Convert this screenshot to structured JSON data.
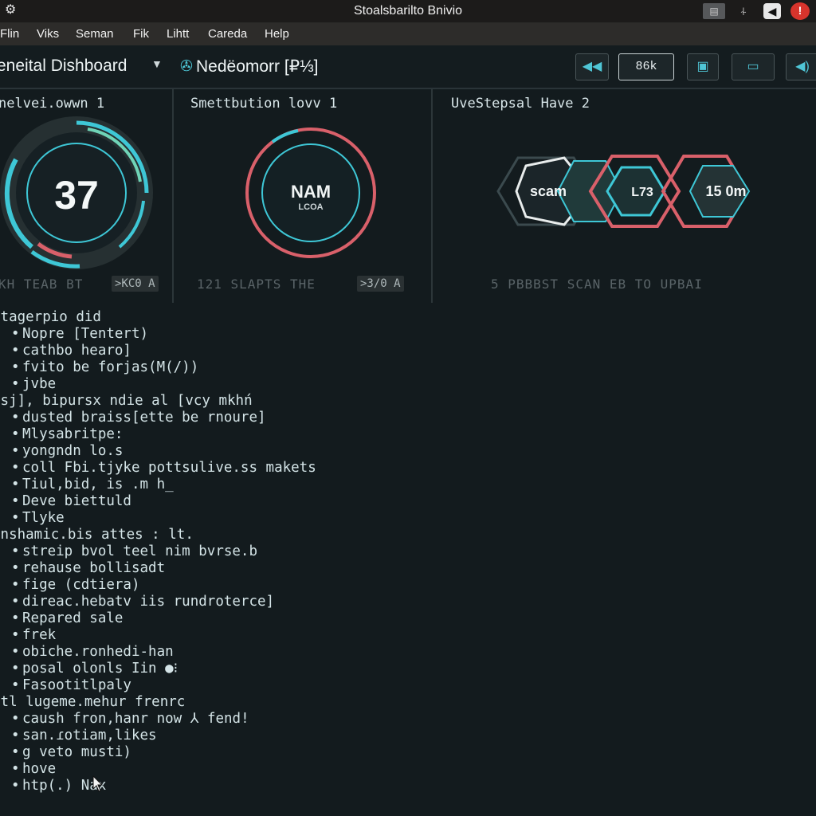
{
  "window": {
    "title": "Stoalsbarilto Bnivio"
  },
  "menu": [
    "Flin",
    "Viks",
    "Seman",
    "Fik",
    "Lihtt",
    "Careda",
    "Help"
  ],
  "toolbar": {
    "dashboard_title": "eneital Dishboard",
    "network_title": "Nedëomorr",
    "network_badge": "[₽⅓]",
    "speed_label": "86k"
  },
  "panels": [
    {
      "title": "nelvei.owwn 1",
      "gauge_value": "37",
      "footer_text": "KH TEAB BT",
      "footer_pill": ">KC0 A"
    },
    {
      "title": "Smettbution lovv 1",
      "gauge_line1": "NAM",
      "gauge_line2": "LCOA",
      "footer_text": "121 SLAPTS THE",
      "footer_pill": ">3/0 A"
    },
    {
      "title": "UveStepsal Have 2",
      "chain": [
        "scam",
        "L73",
        "15 0m"
      ],
      "footer_text": "5 PBBBST SCAN EB TO UPBAI"
    }
  ],
  "log": [
    {
      "kind": "head",
      "text": "stagerpio did"
    },
    {
      "kind": "item",
      "text": "Nopre [Tentert)"
    },
    {
      "kind": "item",
      "text": "cathbo hearo]"
    },
    {
      "kind": "item",
      "text": "fvito be forjas(M(/))"
    },
    {
      "kind": "item",
      "text": "jvbe"
    },
    {
      "kind": "head",
      "text": "gsj], bipursx ndie al [vcy mkhń"
    },
    {
      "kind": "item",
      "text": "dusted braiss[ette be rnoure]"
    },
    {
      "kind": "item",
      "text": "Mlysabritpe:"
    },
    {
      "kind": "item",
      "text": "yongndn lo.s"
    },
    {
      "kind": "item",
      "text": "coll Fbi.tjyke pottsulive.ss makets"
    },
    {
      "kind": "item",
      "text": "Tiul,bid, is .m h_"
    },
    {
      "kind": "item",
      "text": "Deve biettuld"
    },
    {
      "kind": "item",
      "text": "Tlyke"
    },
    {
      "kind": "head",
      "text": "gnshamic.bis attes : lt."
    },
    {
      "kind": "item",
      "text": "streip bvol teel nim bvrse.b"
    },
    {
      "kind": "item",
      "text": "rehause bollisadt"
    },
    {
      "kind": "item",
      "text": "fige (cdtiera)"
    },
    {
      "kind": "item",
      "text": "direac.hebatv iis rundroterce]"
    },
    {
      "kind": "item",
      "text": "Repared sale"
    },
    {
      "kind": "item",
      "text": "frek"
    },
    {
      "kind": "item",
      "text": "obiche.ronhedi-han"
    },
    {
      "kind": "item",
      "text": "posal olonls Iin ●⁝"
    },
    {
      "kind": "item",
      "text": "Fasootitlpaly"
    },
    {
      "kind": "head",
      "text": "utl lugeme.mehur frenrc"
    },
    {
      "kind": "item",
      "text": "caush fron,hanr now ⅄ fend!"
    },
    {
      "kind": "item",
      "text": "san.ɾotiam,likes"
    },
    {
      "kind": "item",
      "text": "g veto musti)"
    },
    {
      "kind": "item",
      "text": "hove"
    },
    {
      "kind": "item",
      "text": "htp(.) Nax"
    }
  ],
  "colors": {
    "accent_cyan": "#3ec7d6",
    "accent_teal": "#6fd4b7",
    "accent_red": "#d9606a",
    "background": "#131b1e"
  },
  "icons": [
    "app-gear-icon",
    "minimize-icon",
    "network-icon",
    "volume-icon",
    "close-icon",
    "rewind-icon",
    "document-icon",
    "bar-icon",
    "speaker-icon"
  ]
}
